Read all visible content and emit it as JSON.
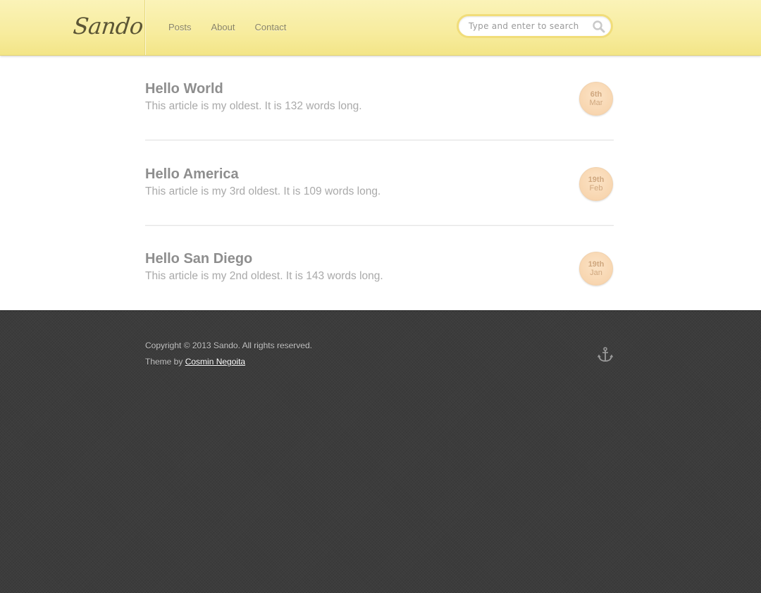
{
  "header": {
    "logo": "Sando",
    "nav": [
      {
        "label": "Posts"
      },
      {
        "label": "About"
      },
      {
        "label": "Contact"
      }
    ],
    "search": {
      "placeholder": "Type and enter to search",
      "value": "",
      "icon": "search-icon"
    }
  },
  "posts": [
    {
      "title": "Hello World",
      "description": "This article is my oldest. It is 132 words long.",
      "date_day": "6th",
      "date_month": "Mar"
    },
    {
      "title": "Hello America",
      "description": "This article is my 3rd oldest. It is 109 words long.",
      "date_day": "19th",
      "date_month": "Feb"
    },
    {
      "title": "Hello San Diego",
      "description": "This article is my 2nd oldest. It is 143 words long.",
      "date_day": "19th",
      "date_month": "Jan"
    }
  ],
  "footer": {
    "copyright": "Copyright © 2013 Sando. All rights reserved.",
    "theme_prefix": "Theme by",
    "theme_author": "Cosmin Negoita",
    "icon": "anchor-icon"
  },
  "colors": {
    "header_bg": "#f7ec9e",
    "date_badge": "#f8d6b0",
    "footer_bg": "#3c3c3c"
  }
}
